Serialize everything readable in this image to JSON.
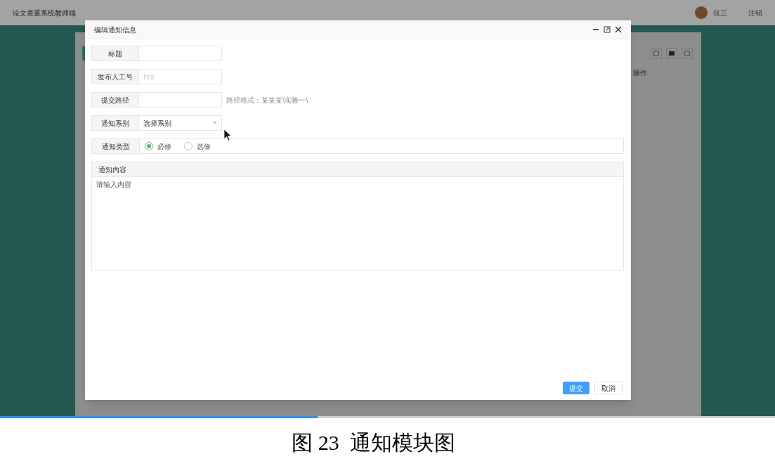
{
  "app": {
    "title": "论文查重系统教师端",
    "user": "张三",
    "logout": "注销"
  },
  "background_table": {
    "column_header": "操作"
  },
  "dialog": {
    "title": "编辑通知信息",
    "fields": [
      {
        "kind": "text",
        "label": "标题"
      },
      {
        "kind": "text",
        "label": "发布人工号",
        "placeholder": "tea"
      },
      {
        "kind": "text",
        "label": "提交路径",
        "hint": "路径格式：某某某\\实验一\\"
      },
      {
        "kind": "select",
        "label": "通知系别",
        "value": "选择系别"
      },
      {
        "kind": "radio",
        "label": "通知类型",
        "options": [
          {
            "label": "必修",
            "selected": true
          },
          {
            "label": "选修",
            "selected": false
          }
        ]
      }
    ],
    "content": {
      "label": "通知内容",
      "placeholder": "请输入内容"
    },
    "buttons": [
      {
        "kind": "primary",
        "label": "提交"
      },
      {
        "kind": "default",
        "label": "取消"
      }
    ]
  },
  "video": {
    "level": 0.41
  },
  "caption": "图 23  通知模块图"
}
